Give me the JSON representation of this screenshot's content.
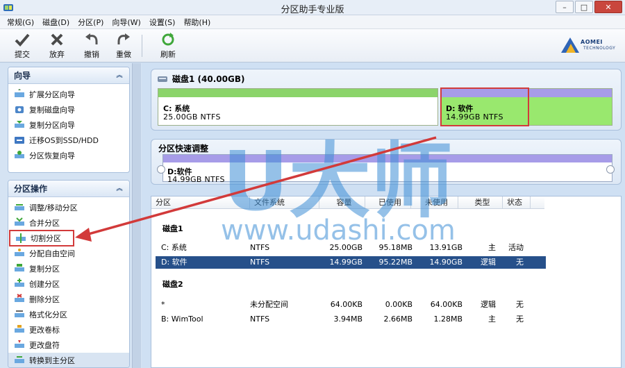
{
  "window": {
    "title": "分区助手专业版",
    "minimize": "–",
    "maximize": "□",
    "close": "✕"
  },
  "menu": [
    "常规(G)",
    "磁盘(D)",
    "分区(P)",
    "向导(W)",
    "设置(S)",
    "帮助(H)"
  ],
  "toolbar": {
    "commit": "提交",
    "discard": "放弃",
    "undo": "撤销",
    "redo": "重做",
    "refresh": "刷新"
  },
  "logo": {
    "name": "AOMEI",
    "sub": "TECHNOLOGY"
  },
  "wizard": {
    "title": "向导",
    "items": [
      "扩展分区向导",
      "复制磁盘向导",
      "复制分区向导",
      "迁移OS到SSD/HDD",
      "分区恢复向导"
    ]
  },
  "operations": {
    "title": "分区操作",
    "items": [
      "调整/移动分区",
      "合并分区",
      "切割分区",
      "分配自由空间",
      "复制分区",
      "创建分区",
      "删除分区",
      "格式化分区",
      "更改卷标",
      "更改盘符",
      "转换到主分区"
    ]
  },
  "disk1": {
    "title": "磁盘1 (40.00GB)",
    "c": {
      "name": "C: 系统",
      "size": "25.00GB NTFS",
      "used_fraction": 1.0
    },
    "d": {
      "name": "D: 软件",
      "size": "14.99GB NTFS",
      "used_fraction": 1.0
    }
  },
  "quick": {
    "title": "分区快速调整",
    "name": "D:软件",
    "size": "14.99GB NTFS"
  },
  "table": {
    "headers": [
      "分区",
      "文件系统",
      "容量",
      "已使用",
      "未使用",
      "类型",
      "状态"
    ],
    "groups": [
      {
        "name": "磁盘1",
        "rows": [
          [
            "C: 系统",
            "NTFS",
            "25.00GB",
            "95.18MB",
            "13.91GB",
            "主",
            "活动"
          ],
          [
            "D: 软件",
            "NTFS",
            "14.99GB",
            "95.22MB",
            "14.90GB",
            "逻辑",
            "无"
          ]
        ]
      },
      {
        "name": "磁盘2",
        "rows": [
          [
            "*",
            "未分配空间",
            "64.00KB",
            "0.00KB",
            "64.00KB",
            "逻辑",
            "无"
          ],
          [
            "B: WimTool",
            "NTFS",
            "3.94MB",
            "2.66MB",
            "1.28MB",
            "主",
            "无"
          ]
        ]
      }
    ]
  },
  "watermark": {
    "cn": "U大师",
    "url": "www.udashi.com"
  },
  "colors": {
    "accent": "#26508a",
    "annotation": "#d23a3a",
    "partition_green": "#8bd46a",
    "partition_purple": "#a79ce8",
    "watermark": "#3f8fd6"
  }
}
